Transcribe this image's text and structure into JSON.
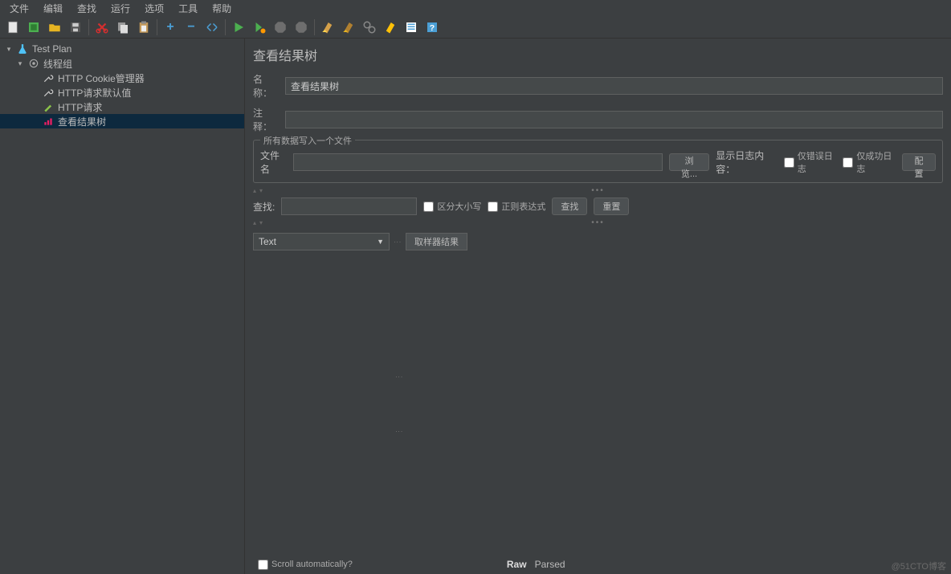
{
  "menu": [
    "文件",
    "编辑",
    "查找",
    "运行",
    "选项",
    "工具",
    "帮助"
  ],
  "tree": {
    "root": "Test Plan",
    "threadGroup": "线程组",
    "items": [
      "HTTP Cookie管理器",
      "HTTP请求默认值",
      "HTTP请求",
      "查看结果树"
    ]
  },
  "panel": {
    "title": "查看结果树",
    "nameLabel": "名称：",
    "nameValue": "查看结果树",
    "commentLabel": "注释：",
    "fileGroup": "所有数据写入一个文件",
    "fileLabel": "文件名",
    "browse": "浏览...",
    "showLog": "显示日志内容：",
    "errOnly": "仅错误日志",
    "succOnly": "仅成功日志",
    "configure": "配置",
    "searchLabel": "查找:",
    "caseSensitive": "区分大小写",
    "regex": "正则表达式",
    "searchBtn": "查找",
    "resetBtn": "重置",
    "renderAs": "Text",
    "samplerTab": "取样器结果",
    "scrollAuto": "Scroll automatically?",
    "rawTab": "Raw",
    "parsedTab": "Parsed"
  },
  "watermark": "@51CTO博客"
}
